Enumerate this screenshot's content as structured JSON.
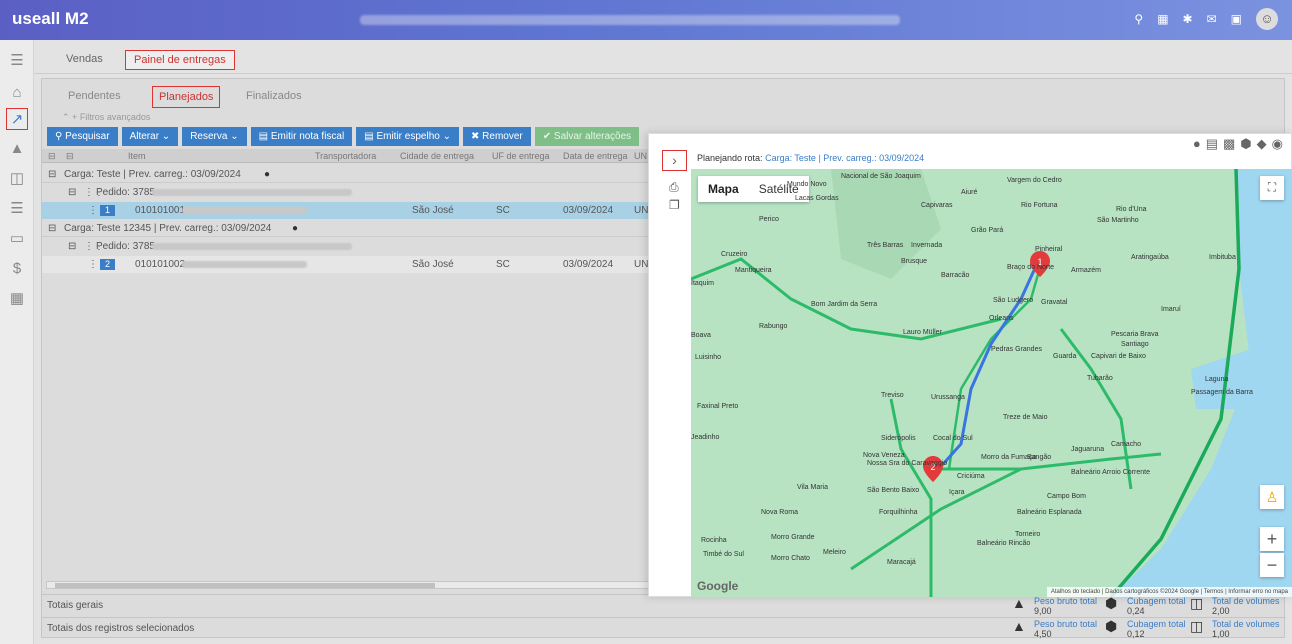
{
  "topbar": {
    "brand": "useall M2",
    "icons": [
      "search-icon",
      "grid-icon",
      "puzzle-icon",
      "mail-icon",
      "chat-icon"
    ]
  },
  "nav": {
    "tabs": [
      "Vendas",
      "Painel de entregas"
    ]
  },
  "subtabs": [
    "Pendentes",
    "Planejados",
    "Finalizados"
  ],
  "filters": "Filtros avançados",
  "toolbar": {
    "search": "Pesquisar",
    "alter": "Alterar",
    "reserve": "Reserva",
    "invoice": "Emitir nota fiscal",
    "mirror": "Emitir espelho",
    "remove": "Remover",
    "save": "Salvar alterações"
  },
  "grid": {
    "columns": [
      "Item",
      "Transportadora",
      "Cidade de entrega",
      "UF de entrega",
      "Data de entrega",
      "UN"
    ],
    "loads": [
      {
        "label": "Carga: Teste | Prev. carreg.: 03/09/2024",
        "order": "Pedido: 3785 -",
        "row_num": "1",
        "item": "010101001 -",
        "city": "São José",
        "uf": "SC",
        "date": "03/09/2024",
        "un": "UN"
      },
      {
        "label": "Carga: Teste 12345 | Prev. carreg.: 03/09/2024",
        "order": "Pedido: 3785 -",
        "row_num": "2",
        "item": "010101002 -",
        "city": "São José",
        "uf": "SC",
        "date": "03/09/2024",
        "un": "UN"
      }
    ]
  },
  "totals": {
    "general_label": "Totais gerais",
    "selected_label": "Totais dos registros selecionados",
    "weight_label": "Peso bruto total",
    "cubage_label": "Cubagem total",
    "volumes_label": "Total de volumes",
    "general": {
      "weight": "9,00",
      "cubage": "0,24",
      "volumes": "2,00"
    },
    "selected": {
      "weight": "4,50",
      "cubage": "0,12",
      "volumes": "1,00"
    }
  },
  "route": {
    "prefix": "Planejando rota:",
    "load": "Carga: Teste | Prev. carreg.: 03/09/2024"
  },
  "map": {
    "type_map": "Mapa",
    "type_satellite": "Satélite",
    "google": "Google",
    "attribution": "Atalhos do teclado | Dados cartográficos ©2024 Google | Termos | Informar erro no mapa",
    "marker1": "1",
    "marker2": "2",
    "cities": [
      "Mundo Novo",
      "Nacional de São Joaquim",
      "Lacas Gordas",
      "Vargem do Cedro",
      "Aiuré",
      "Capivaras",
      "Rio Fortuna",
      "Rio d'Una",
      "Perico",
      "São Martinho",
      "Grão Pará",
      "Cruzeiro",
      "Três Barras",
      "Invernada",
      "Pinheiral",
      "Mantiqueira",
      "Brusque",
      "Barracão",
      "Braço do Norte",
      "Armazém",
      "Aratingaúba",
      "Imbituba",
      "Itaquim",
      "São Ludgero",
      "Gravatal",
      "Imaruí",
      "Bom Jardim da Serra",
      "Rabungo",
      "Orleans",
      "Lauro Müller",
      "Pescaria Brava",
      "Santiago",
      "Boava",
      "Luisinho",
      "Pedras Grandes",
      "Guarda",
      "Capivari de Baixo",
      "Laguna",
      "Tubarão",
      "Treviso",
      "Urussanga",
      "Passagem da Barra",
      "Faxinal Preto",
      "Treze de Maio",
      "Jeadinho",
      "Siderópolis",
      "Cocal do Sul",
      "Jaguaruna",
      "Camacho",
      "Nova Veneza",
      "Nossa Sra do Caravaggio",
      "Morro da Fumaça",
      "Sangão",
      "Criciúma",
      "Balneário Arroio Corrente",
      "Vila Maria",
      "São Bento Baixo",
      "Içara",
      "Campo Bom",
      "Nova Roma",
      "Forquilhinha",
      "Balneário Esplanada",
      "Rocinha",
      "Morro Grande",
      "Torneiro",
      "Timbé do Sul",
      "Morro Chato",
      "Meleiro",
      "Balneário Rincão",
      "Maracajá"
    ]
  },
  "colors": {
    "accent": "#3a7ec8",
    "highlight": "#d33333",
    "header": "#5b5fc4"
  }
}
